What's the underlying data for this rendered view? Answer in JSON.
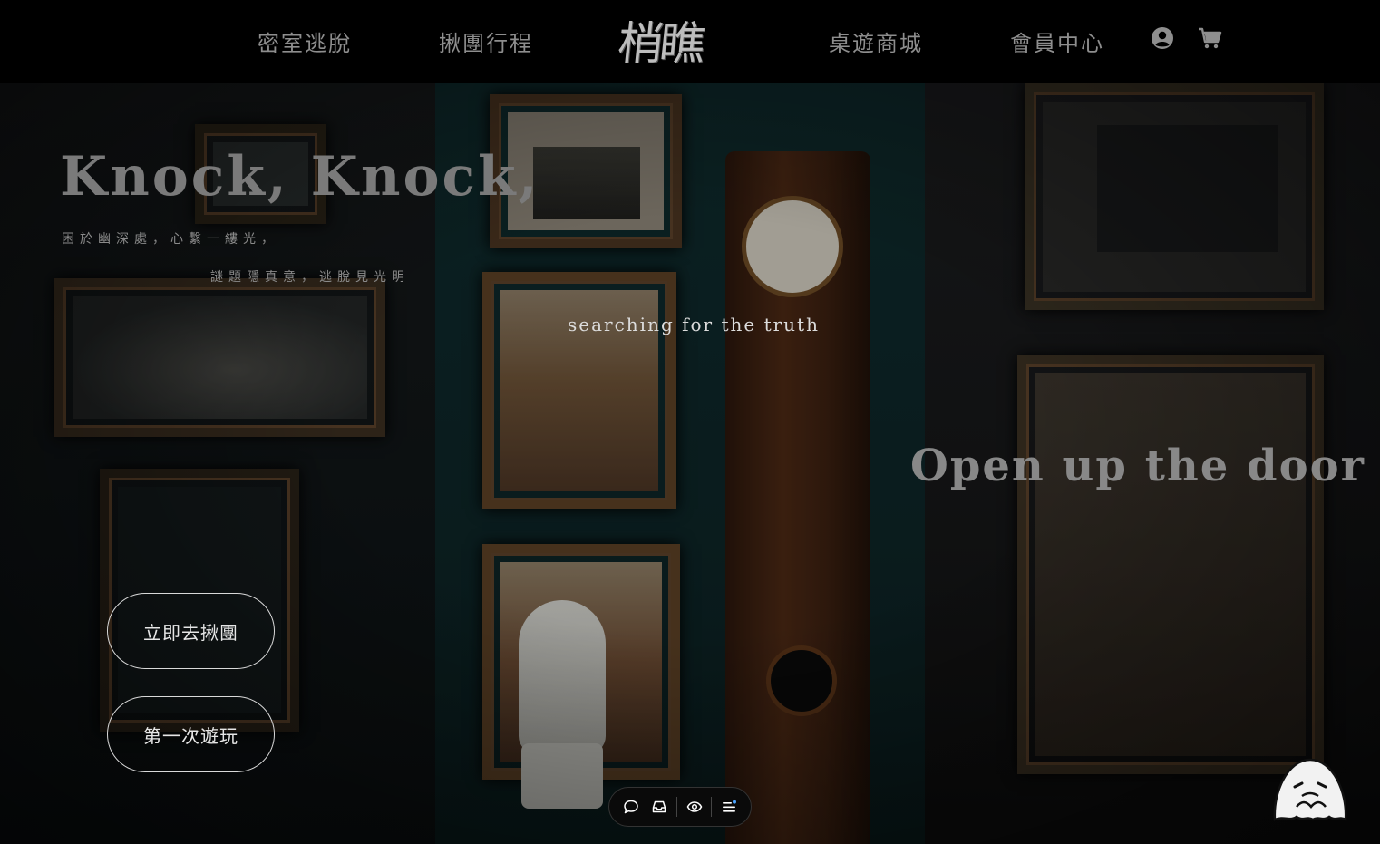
{
  "header": {
    "nav_left": [
      "密室逃脫",
      "揪團行程"
    ],
    "logo": "梢瞧",
    "nav_right": [
      "桌遊商城",
      "會員中心"
    ],
    "icons": [
      "user-circle-icon",
      "cart-icon"
    ]
  },
  "hero": {
    "headline": "Knock, Knock,",
    "tagline_1": "困於幽深處，心繫一縷光，",
    "tagline_2": "謎題隱真意，逃脫見光明",
    "center_text": "searching for the truth",
    "right_headline": "Open up the door"
  },
  "cta": {
    "primary": "立即去揪團",
    "secondary": "第一次遊玩"
  },
  "toolbar": {
    "icons": [
      "chat-bubble-icon",
      "inbox-icon",
      "eye-icon",
      "menu-list-icon"
    ]
  },
  "colors": {
    "background": "#000000",
    "nav_text": "#8e8e8e",
    "button_border": "#d9d9d9",
    "accent_dot": "#4aa3ff"
  }
}
